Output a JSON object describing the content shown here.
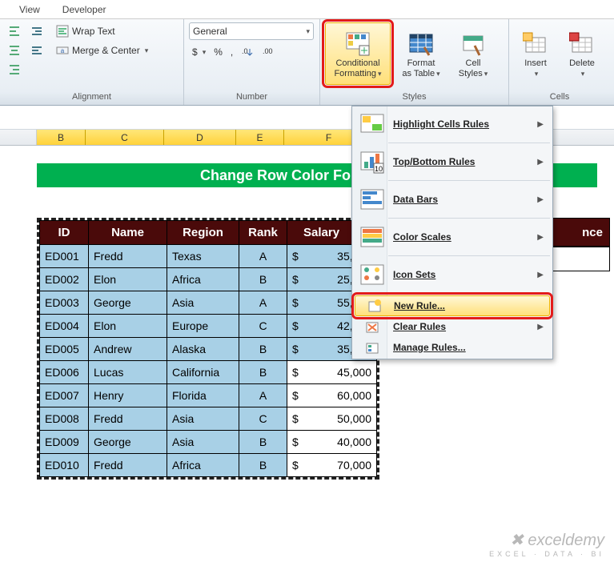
{
  "tabs": {
    "view": "View",
    "developer": "Developer"
  },
  "ribbon": {
    "alignment": {
      "label": "Alignment",
      "wrap": "Wrap Text",
      "merge": "Merge & Center"
    },
    "number": {
      "label": "Number",
      "format": "General",
      "dollar": "$",
      "percent": "%",
      "comma": ","
    },
    "styles": {
      "label": "Styles",
      "cond_fmt_l1": "Conditional",
      "cond_fmt_l2": "Formatting",
      "fmt_tbl_l1": "Format",
      "fmt_tbl_l2": "as Table",
      "cell_st_l1": "Cell",
      "cell_st_l2": "Styles"
    },
    "cells": {
      "label": "Cells",
      "insert": "Insert",
      "delete": "Delete"
    }
  },
  "menu": {
    "highlight": "Highlight Cells Rules",
    "topbottom": "Top/Bottom Rules",
    "databars": "Data Bars",
    "colorscales": "Color Scales",
    "iconsets": "Icon Sets",
    "newrule": "New Rule...",
    "clear": "Clear Rules",
    "manage": "Manage Rules..."
  },
  "columns": [
    "B",
    "C",
    "D",
    "E",
    "F"
  ],
  "banner": "Change Row Color For Single Cell",
  "table": {
    "headers": {
      "id": "ID",
      "name": "Name",
      "region": "Region",
      "rank": "Rank",
      "salary": "Salary",
      "extra": "nce"
    },
    "rows": [
      {
        "id": "ED001",
        "name": "Fredd",
        "region": "Texas",
        "rank": "A",
        "salary": "35,000"
      },
      {
        "id": "ED002",
        "name": "Elon",
        "region": "Africa",
        "rank": "B",
        "salary": "25,000"
      },
      {
        "id": "ED003",
        "name": "George",
        "region": "Asia",
        "rank": "A",
        "salary": "55,000"
      },
      {
        "id": "ED004",
        "name": "Elon",
        "region": "Europe",
        "rank": "C",
        "salary": "42,000"
      },
      {
        "id": "ED005",
        "name": "Andrew",
        "region": "Alaska",
        "rank": "B",
        "salary": "35,000"
      },
      {
        "id": "ED006",
        "name": "Lucas",
        "region": "California",
        "rank": "B",
        "salary": "45,000"
      },
      {
        "id": "ED007",
        "name": "Henry",
        "region": "Florida",
        "rank": "A",
        "salary": "60,000"
      },
      {
        "id": "ED008",
        "name": "Fredd",
        "region": "Asia",
        "rank": "C",
        "salary": "50,000"
      },
      {
        "id": "ED009",
        "name": "George",
        "region": "Asia",
        "rank": "B",
        "salary": "40,000"
      },
      {
        "id": "ED010",
        "name": "Fredd",
        "region": "Africa",
        "rank": "B",
        "salary": "70,000"
      }
    ],
    "currency": "$"
  },
  "watermark": {
    "brand": "exceldemy",
    "tag": "EXCEL · DATA · BI"
  }
}
